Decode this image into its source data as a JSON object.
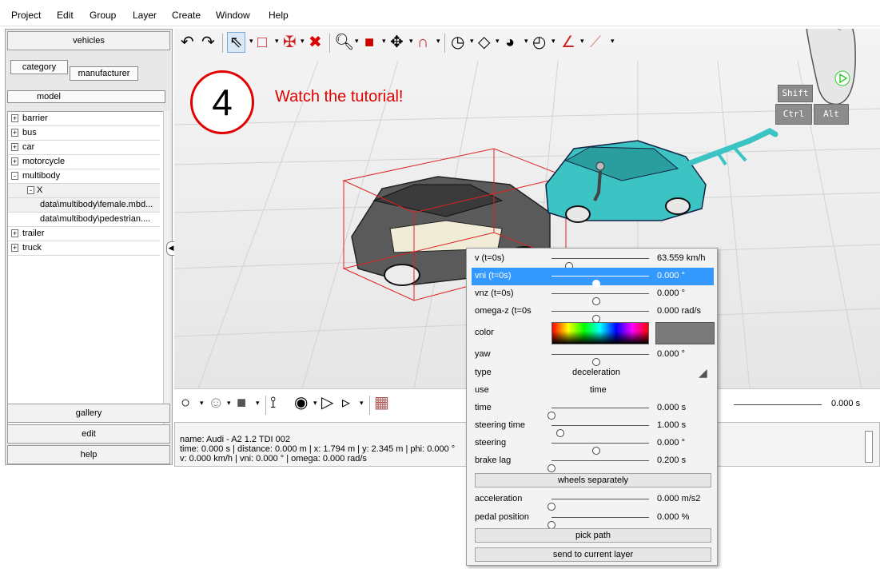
{
  "menu": [
    "Project",
    "Edit",
    "Group",
    "Layer",
    "Create",
    "Window",
    "Help"
  ],
  "left_panel": {
    "header_button": "vehicles",
    "tabs": {
      "category": "category",
      "manufacturer": "manufacturer"
    },
    "column_header": "model",
    "tree": [
      {
        "sign": "+",
        "label": "barrier"
      },
      {
        "sign": "+",
        "label": "bus"
      },
      {
        "sign": "+",
        "label": "car"
      },
      {
        "sign": "+",
        "label": "motorcycle"
      },
      {
        "sign": "-",
        "label": "multibody"
      },
      {
        "sign": "-",
        "label": "X"
      },
      {
        "sign": "",
        "label": "data\\multibody\\female.mbd..."
      },
      {
        "sign": "",
        "label": "data\\multibody\\pedestrian...."
      },
      {
        "sign": "+",
        "label": "trailer"
      },
      {
        "sign": "+",
        "label": "truck"
      }
    ],
    "bottom_buttons": {
      "gallery": "gallery",
      "edit": "edit",
      "help": "help"
    }
  },
  "toolbar_icons": [
    "undo-icon",
    "redo-icon",
    "select-arrow-icon",
    "rectangle-select-icon",
    "cross-tool-icon",
    "delete-icon",
    "zoom-icon",
    "cube-icon",
    "move-icon",
    "magnet-icon",
    "gauge-icon",
    "plane-icon",
    "circle-gauge-icon",
    "dial-icon",
    "measure-icon",
    "ruler-tool-icon"
  ],
  "overlay": {
    "step": "4",
    "text": "Watch the tutorial!",
    "color": "#e00000"
  },
  "keys": {
    "shift": "Shift",
    "ctrl": "Ctrl",
    "alt": "Alt"
  },
  "bottom_toolbar": {
    "time_value": "0.000 s"
  },
  "status": {
    "line1": "name: Audi - A2 1.2 TDI 002",
    "line2": "time: 0.000 s | distance: 0.000 m | x: 1.794 m | y: 2.345 m | phi: 0.000 °",
    "line3": "v: 0.000 km/h | vni: 0.000 ° | omega: 0.000 rad/s"
  },
  "popup": {
    "v": {
      "label": "v (t=0s)",
      "value": "63.559 km/h",
      "pos": 0.2
    },
    "vni": {
      "label": "vni (t=0s)",
      "value": "0.000 °",
      "pos": 0.5
    },
    "vnz": {
      "label": "vnz (t=0s)",
      "value": "0.000 °",
      "pos": 0.5
    },
    "omega": {
      "label": "omega-z (t=0s",
      "value": "0.000 rad/s",
      "pos": 0.5
    },
    "color": {
      "label": "color",
      "swatch": "#7a7a7a"
    },
    "yaw": {
      "label": "yaw",
      "value": "0.000 °",
      "pos": 0.5
    },
    "type": {
      "label": "type",
      "value": "deceleration"
    },
    "use": {
      "label": "use",
      "value": "time"
    },
    "time": {
      "label": "time",
      "value": "0.000 s",
      "pos": 0.0
    },
    "steering_time": {
      "label": "steering time",
      "value": "1.000 s",
      "pos": 0.1
    },
    "steering": {
      "label": "steering",
      "value": "0.000 °",
      "pos": 0.5
    },
    "brake_lag": {
      "label": "brake lag",
      "value": "0.200 s",
      "pos": 0.0
    },
    "wheels_btn": "wheels separately",
    "acceleration": {
      "label": "acceleration",
      "value": "0.000 m/s2",
      "pos": 0.0
    },
    "pedal": {
      "label": "pedal position",
      "value": "0.000 %",
      "pos": 0.0
    },
    "pick_path_btn": "pick path",
    "send_layer_btn": "send to current layer"
  }
}
